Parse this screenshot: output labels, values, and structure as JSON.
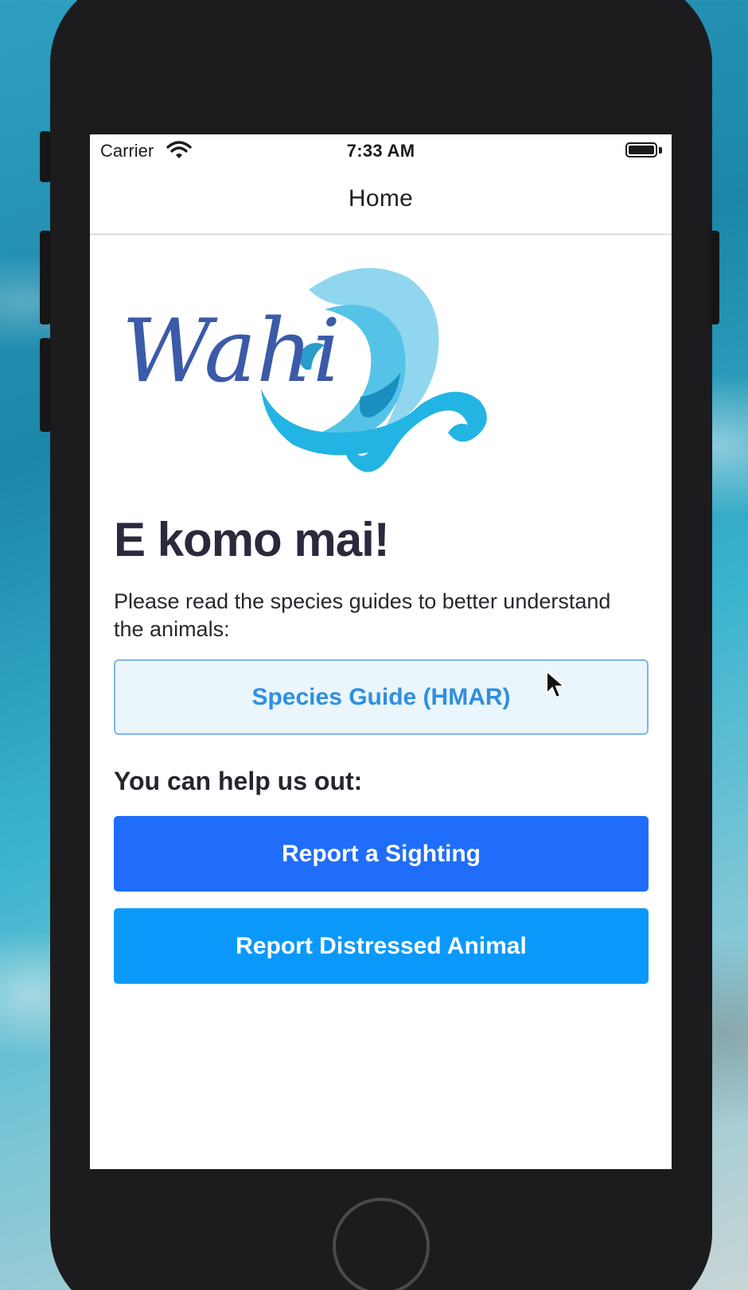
{
  "status_bar": {
    "carrier": "Carrier",
    "time": "7:33 AM",
    "wifi_icon": "wifi-icon",
    "battery_icon": "battery-icon",
    "battery_level": 1.0
  },
  "nav": {
    "title": "Home"
  },
  "logo": {
    "text": "Wahi",
    "colors": {
      "script": "#3b5aa8",
      "wave_light": "#7fd0ea",
      "wave_mid": "#2db6e4",
      "wave_dark": "#1a8fc0"
    }
  },
  "content": {
    "heading": "E komo mai!",
    "intro": "Please read the species guides to better understand the animals:",
    "guide_button": "Species Guide (HMAR)",
    "help_heading": "You can help us out:",
    "report_sighting_button": "Report a Sighting",
    "report_distressed_button": "Report Distressed Animal"
  },
  "colors": {
    "sighting_button": "#1f6dfa",
    "distressed_button": "#0a99fb",
    "guide_button_text": "#2f8fe0",
    "guide_button_bg": "#eaf5fc",
    "phone_frame": "#1c1c1e"
  }
}
